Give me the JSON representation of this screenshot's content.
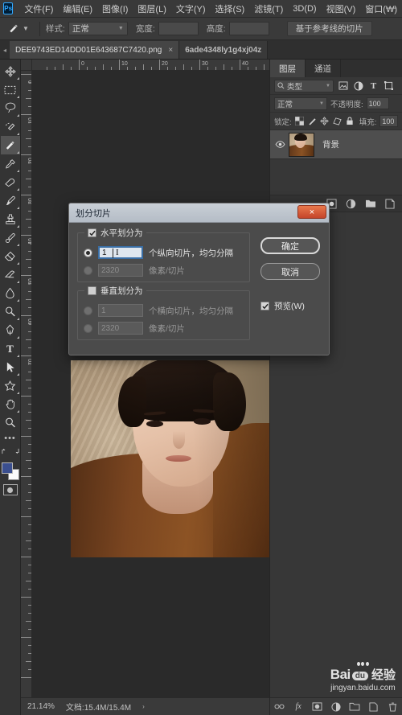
{
  "app": {
    "logo": "ps-logo",
    "menus": [
      {
        "label": "文件(F)"
      },
      {
        "label": "编辑(E)"
      },
      {
        "label": "图像(I)"
      },
      {
        "label": "图层(L)"
      },
      {
        "label": "文字(Y)"
      },
      {
        "label": "选择(S)"
      },
      {
        "label": "滤镜(T)"
      },
      {
        "label": "3D(D)"
      },
      {
        "label": "视图(V)"
      },
      {
        "label": "窗口(W)"
      }
    ],
    "minimize_label": "—"
  },
  "options_bar": {
    "tool_icon": "slice-tool-icon",
    "style_label": "样式:",
    "style_value": "正常",
    "width_label": "宽度:",
    "width_value": "",
    "height_label": "高度:",
    "height_value": "",
    "guides_button": "基于参考线的切片"
  },
  "tabs": {
    "items": [
      {
        "title": "DEE9743ED14DD01E643687C7420.png",
        "close": "×",
        "active": true
      },
      {
        "title": "6ade4348ly1g4xj04z",
        "active": false
      }
    ]
  },
  "toolbar": {
    "tools": [
      {
        "name": "move-tool",
        "selected": false
      },
      {
        "name": "marquee-tool",
        "selected": false
      },
      {
        "name": "lasso-tool",
        "selected": false
      },
      {
        "name": "quick-selection-tool",
        "selected": false
      },
      {
        "name": "slice-tool",
        "selected": true
      },
      {
        "name": "eyedropper-tool",
        "selected": false
      },
      {
        "name": "healing-brush-tool",
        "selected": false
      },
      {
        "name": "brush-tool",
        "selected": false
      },
      {
        "name": "clone-stamp-tool",
        "selected": false
      },
      {
        "name": "history-brush-tool",
        "selected": false
      },
      {
        "name": "eraser-tool",
        "selected": false
      },
      {
        "name": "gradient-tool",
        "selected": false
      },
      {
        "name": "blur-tool",
        "selected": false
      },
      {
        "name": "dodge-tool",
        "selected": false
      },
      {
        "name": "pen-tool",
        "selected": false
      },
      {
        "name": "type-tool",
        "selected": false
      },
      {
        "name": "path-selection-tool",
        "selected": false
      },
      {
        "name": "shape-tool",
        "selected": false
      },
      {
        "name": "hand-tool",
        "selected": false
      },
      {
        "name": "zoom-tool",
        "selected": false
      },
      {
        "name": "edit-toolbar-tool",
        "selected": false
      }
    ],
    "foreground_color": "#3b4f8f",
    "background_color": "#fbfbfb"
  },
  "rulers": {
    "horizontal_ticks": [
      "10",
      "20",
      "30",
      "40"
    ],
    "vertical_ticks": [
      "0",
      "10",
      "20",
      "30",
      "40",
      "50",
      "60",
      "70"
    ],
    "origin": "0"
  },
  "dialog": {
    "title": "划分切片",
    "close_label": "×",
    "horizontal": {
      "checkbox_checked": true,
      "label": "水平划分为",
      "row1": {
        "radio_selected": true,
        "value": "1",
        "text": "个纵向切片，均匀分隔"
      },
      "row2": {
        "radio_selected": false,
        "value": "2320",
        "text": "像素/切片"
      }
    },
    "vertical": {
      "checkbox_checked": false,
      "label": "垂直划分为",
      "row1": {
        "radio_selected": false,
        "value": "1",
        "text": "个横向切片，均匀分隔"
      },
      "row2": {
        "radio_selected": false,
        "value": "2320",
        "text": "像素/切片"
      }
    },
    "ok_button": "确定",
    "cancel_button": "取消",
    "preview_checkbox_checked": true,
    "preview_label": "预览(W)"
  },
  "panels": {
    "tabs": [
      {
        "label": "图层",
        "active": true
      },
      {
        "label": "通道",
        "active": false
      }
    ],
    "filter_placeholder": "类型",
    "filter_icons": [
      "pixel-filter-icon",
      "adjustment-filter-icon",
      "type-filter-icon",
      "shape-filter-icon"
    ],
    "blend_mode": "正常",
    "opacity_label": "不透明度:",
    "opacity_value": "100",
    "lock_label": "锁定:",
    "lock_icons": [
      "lock-transparent-icon",
      "lock-image-icon",
      "lock-position-icon",
      "lock-artboard-icon",
      "lock-all-icon"
    ],
    "fill_label": "填充:",
    "fill_value": "100",
    "layers": [
      {
        "name": "背景",
        "visible": true,
        "thumbnail": "portrait-thumbnail"
      }
    ],
    "footer_icons": [
      "link-icon",
      "fx-icon",
      "mask-icon",
      "adjustment-icon",
      "group-icon",
      "new-layer-icon",
      "delete-icon"
    ]
  },
  "status_bar": {
    "zoom": "21.14%",
    "doc_info": "文档:15.4M/15.4M",
    "arrow": "›"
  },
  "watermark": {
    "bai": "Bai",
    "du": "du",
    "jingyan": "经验",
    "url": "jingyan.baidu.com"
  },
  "colors": {
    "accent_blue": "#31a8ff",
    "dialog_close_red": "#c5452a",
    "focus_border": "#3a6ea5",
    "panel_bg": "#373737",
    "canvas_bg": "#2a2a2a"
  }
}
